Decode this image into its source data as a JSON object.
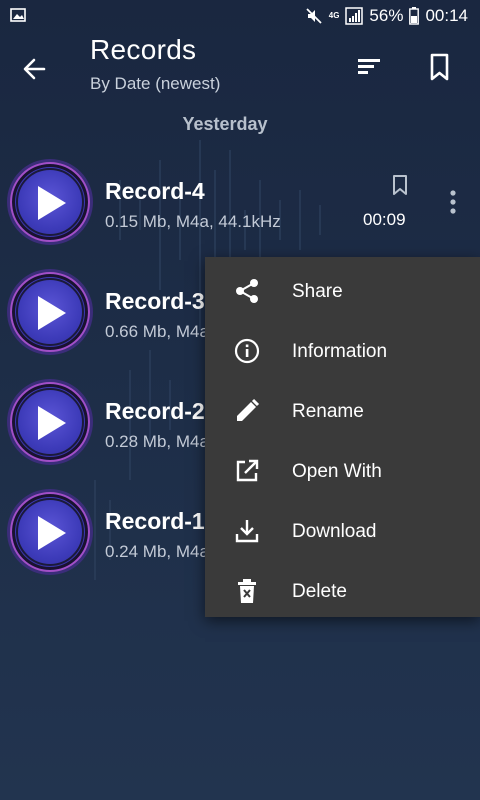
{
  "status_bar": {
    "network_label": "4G",
    "battery_percent": "56%",
    "time": "00:14",
    "icons": [
      "image-icon",
      "mute-icon",
      "signal-icon",
      "battery-icon"
    ]
  },
  "toolbar": {
    "title": "Records",
    "subtitle": "By Date (newest)",
    "icons": [
      "back-arrow-icon",
      "sort-icon",
      "bookmark-icon"
    ]
  },
  "section_header": "Yesterday",
  "records": [
    {
      "name": "Record-4",
      "meta": "0.15 Mb, M4a, 44.1kHz",
      "duration": "00:09"
    },
    {
      "name": "Record-3",
      "meta": "0.66 Mb, M4a",
      "duration": ""
    },
    {
      "name": "Record-2",
      "meta": "0.28 Mb, M4a",
      "duration": ""
    },
    {
      "name": "Record-1",
      "meta": "0.24 Mb, M4a",
      "duration": ""
    }
  ],
  "menu": {
    "items": [
      {
        "label": "Share",
        "icon": "share-icon"
      },
      {
        "label": "Information",
        "icon": "info-icon"
      },
      {
        "label": "Rename",
        "icon": "pencil-icon"
      },
      {
        "label": "Open With",
        "icon": "open-external-icon"
      },
      {
        "label": "Download",
        "icon": "download-icon"
      },
      {
        "label": "Delete",
        "icon": "trash-icon"
      }
    ]
  },
  "colors": {
    "background": "#1d2d47",
    "menu_background": "#3a3a3a",
    "play_disc": "#3c3ab8",
    "play_ring": "#a24fc7"
  }
}
